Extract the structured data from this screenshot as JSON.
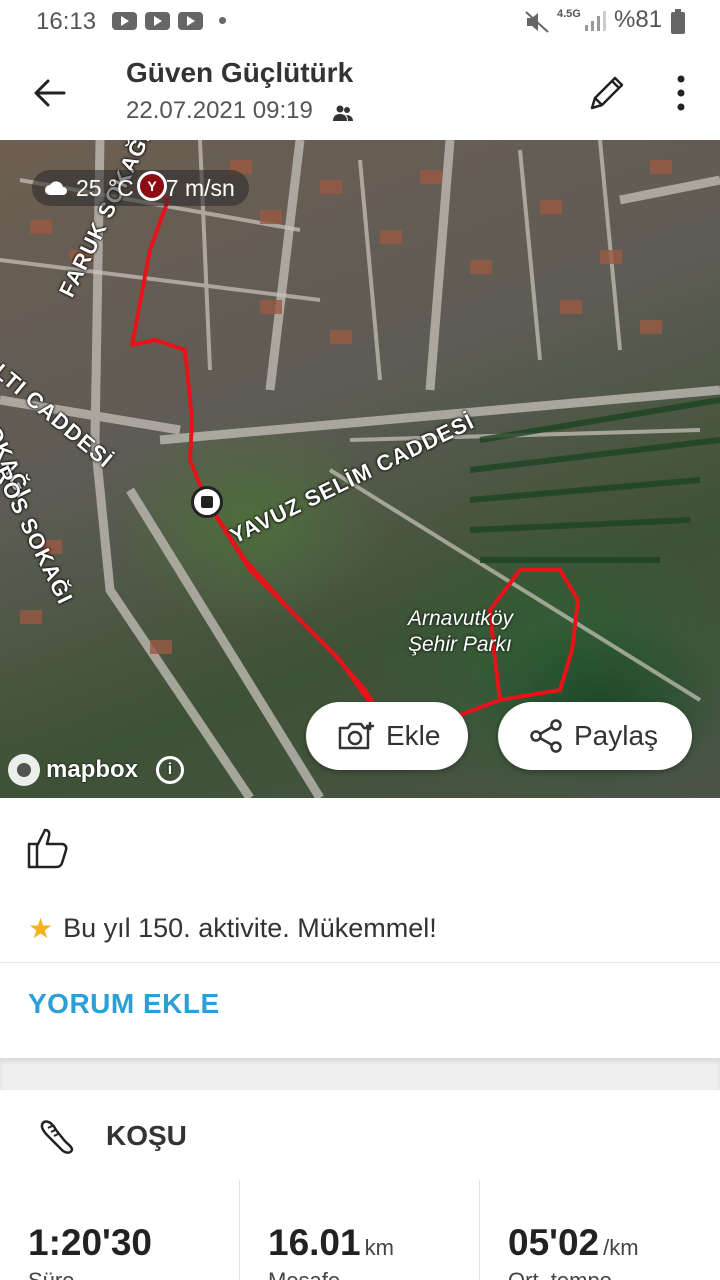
{
  "status_bar": {
    "time": "16:13",
    "network": "4.5G",
    "battery": "%81"
  },
  "header": {
    "title": "Güven Güçlütürk",
    "subtitle": "22.07.2021 09:19"
  },
  "map": {
    "weather": {
      "temperature": "25 °C",
      "wind": "7 m/sn"
    },
    "start_marker": "Y",
    "street_labels": [
      "FARUK SOKAĞI",
      "SOKAĞI",
      "ALTI CADDESİ",
      "ROS SOKAĞI",
      "YAVUZ SELİM CADDESİ"
    ],
    "park_label_line1": "Arnavutköy",
    "park_label_line2": "Şehir Parkı",
    "attribution": "mapbox",
    "info": "i",
    "add_photo_label": "Ekle",
    "share_label": "Paylaş"
  },
  "achievement": "Bu yıl 150. aktivite. Mükemmel!",
  "comment_link": "YORUM EKLE",
  "activity": {
    "sport": "KOŞU",
    "stats": [
      {
        "value": "1:20'30",
        "unit": "",
        "label": "Süre"
      },
      {
        "value": "16.01",
        "unit": "km",
        "label": "Mesafe"
      },
      {
        "value": "05'02",
        "unit": "/km",
        "label": "Ort. tempo"
      }
    ]
  },
  "colors": {
    "route": "#e8121b",
    "link": "#2b9fd6",
    "star": "#f6b21c"
  }
}
